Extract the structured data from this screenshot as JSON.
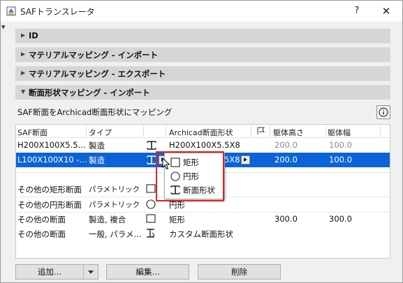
{
  "window": {
    "title": "SAFトランスレータ",
    "help_label": "?",
    "close_label": "✕"
  },
  "sections": [
    {
      "label": "ID",
      "expanded": false
    },
    {
      "label": "マテリアルマッピング - インポート",
      "expanded": false
    },
    {
      "label": "マテリアルマッピング - エクスポート",
      "expanded": false
    },
    {
      "label": "断面形状マッピング - インポート",
      "expanded": true
    }
  ],
  "subtitle": "SAF断面をArchicad断面形状にマッピング",
  "table": {
    "headers": [
      "SAF断面",
      "タイプ",
      "",
      "Archicad断面形状",
      "",
      "躯体高さ",
      "躯体幅"
    ],
    "rows": [
      {
        "saf": "H200X100X5.5...",
        "type": "製造",
        "icon": "i-beam-icon",
        "archicad": "H200X100X5.5X8",
        "height": "200.0",
        "width": "100.0",
        "selected": false,
        "muted": true
      },
      {
        "saf": "L100X100X10 -...",
        "type": "製造",
        "icon": "i-beam-icon",
        "archicad": "5X8",
        "height": "200.0",
        "width": "100.0",
        "selected": true,
        "muted": false
      }
    ],
    "other_rows": [
      {
        "saf": "その他の矩形断面",
        "type": "パラメトリック",
        "icon": "rectangle-icon",
        "archicad": "",
        "height": "",
        "width": ""
      },
      {
        "saf": "その他の円形断面",
        "type": "パラメトリック",
        "icon": "circle-icon",
        "archicad": "円形",
        "height": "",
        "width": ""
      },
      {
        "saf": "その他の断面",
        "type": "製造, 複合",
        "icon": "rectangle-icon",
        "archicad": "矩形",
        "height": "300.0",
        "width": "300.0"
      },
      {
        "saf": "その他の断面",
        "type": "一般, パラメ...",
        "icon": "custom-profile-icon",
        "archicad": "カスタム断面形状",
        "height": "",
        "width": ""
      }
    ]
  },
  "popup_menu": [
    {
      "label": "矩形",
      "icon": "rectangle-icon"
    },
    {
      "label": "円形",
      "icon": "circle-icon"
    },
    {
      "label": "断面形状",
      "icon": "i-beam-icon"
    }
  ],
  "buttons": {
    "add": "追加...",
    "edit": "編集...",
    "delete": "削除"
  },
  "colors": {
    "selection": "#0a64d6",
    "highlight_box": "#e02020",
    "section_bg": "#d6d6d6"
  }
}
